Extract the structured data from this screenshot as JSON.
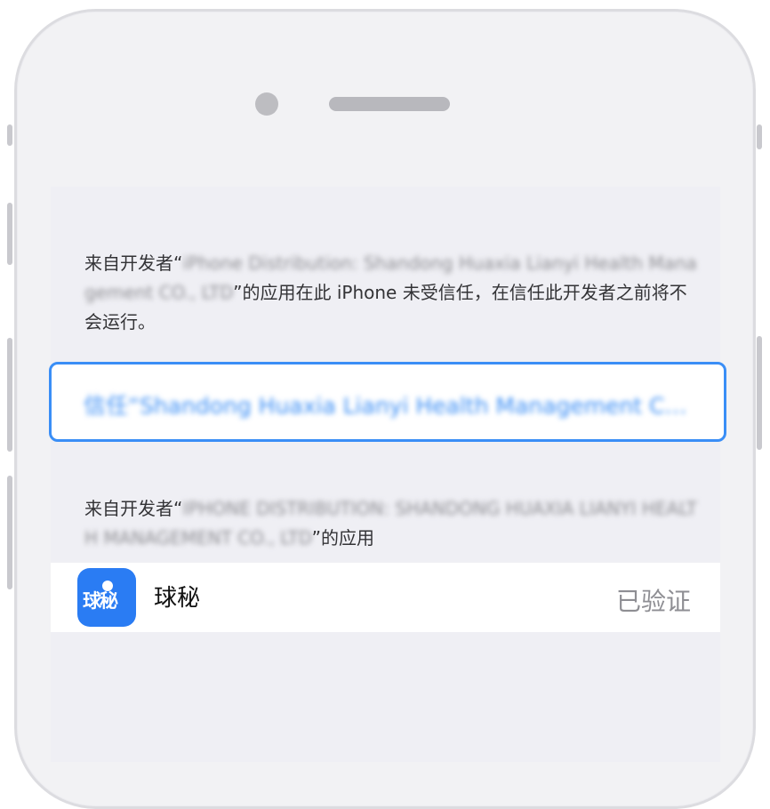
{
  "dialog": {
    "trust_prefix": "来自开发者“",
    "trust_blurred_developer": "iPhone Distribution: Shandong Huaxia Lianyi Health Management CO., LTD",
    "trust_suffix": "”的应用在此 iPhone 未受信任，在信任此开发者之前将不会运行。",
    "trust_button_label": "信任“Shandong Huaxia Lianyi Health Management CO., LTD”",
    "apps_prefix": "来自开发者“",
    "apps_blurred_developer": "IPHONE DISTRIBUTION: SHANDONG HUAXIA LIANYI HEALTH MANAGEMENT CO., LTD",
    "apps_suffix": "”的应用"
  },
  "app": {
    "icon_text": "球秘",
    "name": "球秘",
    "status": "已验证"
  },
  "colors": {
    "accent": "#3a8ef6",
    "app_icon": "#2a7cf3",
    "screen_bg": "#efeff4"
  }
}
